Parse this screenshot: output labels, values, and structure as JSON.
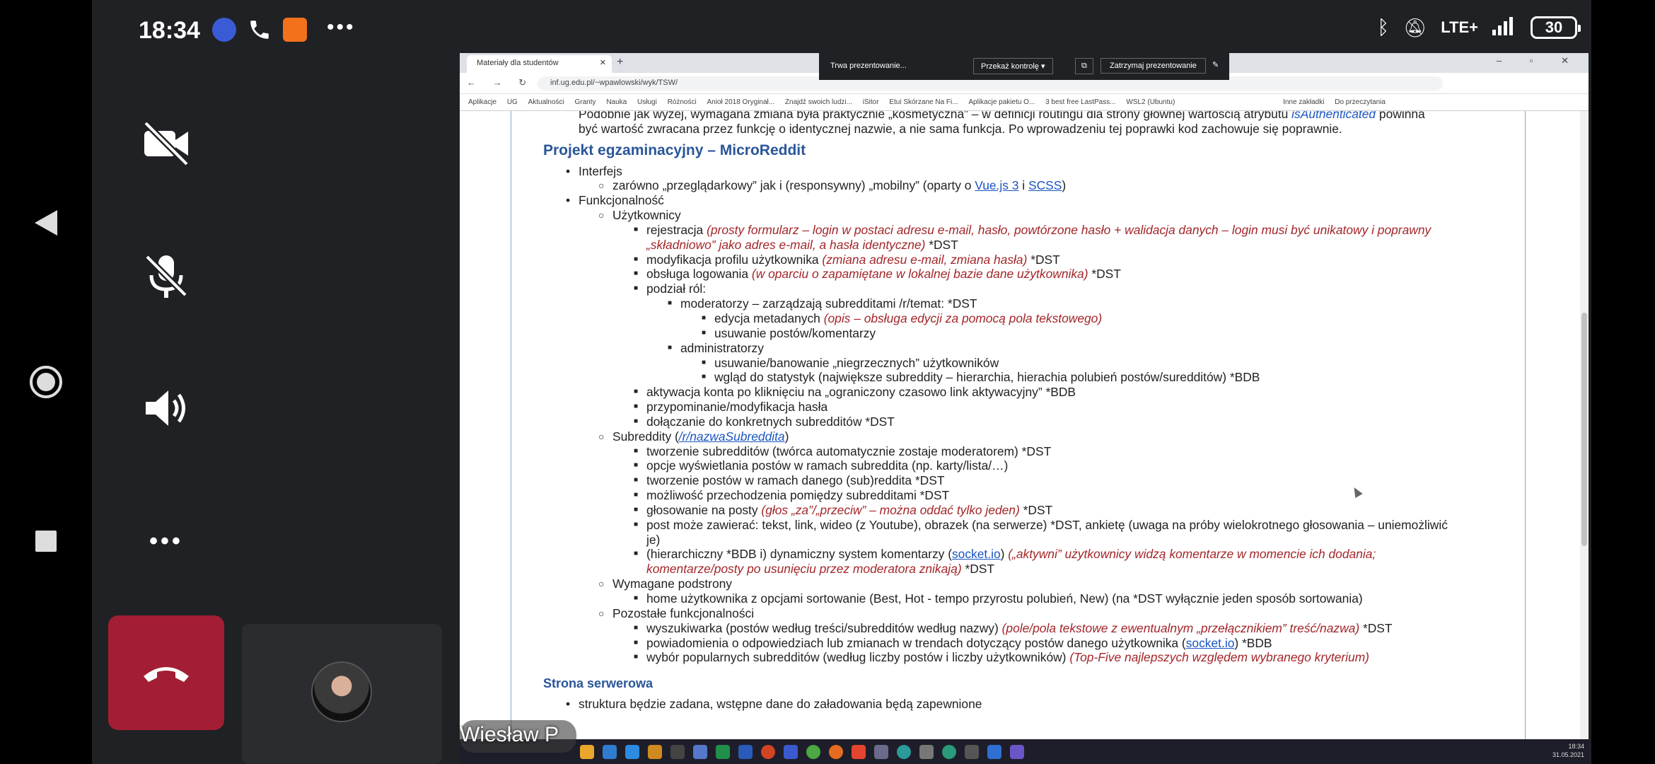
{
  "status": {
    "time": "18:34",
    "network": "LTE+",
    "battery": "30"
  },
  "call": {
    "participant_name": "Wiesław P"
  },
  "browser": {
    "tab_title": "Materiały dla studentów",
    "url": "inf.ug.edu.pl/~wpawlowski/wyk/TSW/",
    "bookmarks": [
      "Aplikacje",
      "UG",
      "Aktualności",
      "Granty",
      "Nauka",
      "Usługi",
      "Różności",
      "Anioł 2018 Oryginał...",
      "Znajdź swoich ludzi...",
      "iSitor",
      "Etui Skórzane Na Fi...",
      "Aplikacje pakietu O...",
      "3 best free LastPass...",
      "WSL2 (Ubuntu)",
      "Inne zakładki",
      "Do przeczytania"
    ],
    "presenting": {
      "status": "Trwa prezentowanie...",
      "give_control": "Przekaż kontrolę",
      "stop": "Zatrzymaj prezentowanie"
    }
  },
  "doc": {
    "intro_a": "Podobnie jak wyżej, wymagana zmiana była praktycznie „kosmetyczna” – w definicji routingu dla strony głównej wartością atrybutu ",
    "intro_code": "isAuthenticated",
    "intro_b": " powinna",
    "intro_line2": "być wartość zwracana przez funkcję o identycznej nazwie, a nie sama funkcja. Po wprowadzeniu tej poprawki kod zachowuje się poprawnie.",
    "h_project": "Projekt egzaminacyjny – MicroReddit",
    "interfejs": "Interfejs",
    "interfejs_sub_a": "zarówno „przeglądarkowy” jak i (responsywny) „mobilny” (oparty o ",
    "vue": "Vue.js 3",
    "and": " i ",
    "scss": "SCSS",
    "close_paren": ")",
    "funkcjonalnosc": "Funkcjonalność",
    "uzytkownicy": "Użytkownicy",
    "rejestracja": "rejestracja ",
    "rejestracja_it": "(prosty formularz – login w postaci adresu e-mail, hasło, powtórzone hasło + walidacja danych – login musi być unikatowy i poprawny",
    "rejestracja_it2": "„składniowo” jako adres e-mail, a hasła identyczne)",
    "dst": " *DST",
    "modyfikacja": "modyfikacja profilu użytkownika ",
    "modyfikacja_it": "(zmiana adresu e-mail, zmiana hasła)",
    "logowanie": "obsługa logowania ",
    "logowanie_it": "(w oparciu o zapamiętane w lokalnej bazie dane użytkownika)",
    "podzial": "podział ról:",
    "moderatorzy": "moderatorzy – zarządzają subredditami /r/temat: *DST",
    "edycja": "edycja metadanych ",
    "edycja_it": "(opis – obsługa edycji za pomocą pola tekstowego)",
    "usuwanie_postow": "usuwanie postów/komentarzy",
    "administratorzy": "administratorzy",
    "banowanie": "usuwanie/banowanie „niegrzecznych” użytkowników",
    "statystyki": "wgląd do statystyk (największe subreddity – hierarchia, hierachia polubień postów/suredditów) *BDB",
    "aktywacja": "aktywacja konta po kliknięciu na „ograniczony czasowo link aktywacyjny” *BDB",
    "przypominanie": "przypominanie/modyfikacja hasła",
    "dolaczanie": "dołączanie do konkretnych subredditów *DST",
    "subreddity_a": "Subreddity (",
    "subreddity_link": "/r/nazwaSubreddita",
    "tworzenie_sub": "tworzenie subredditów (twórca automatycznie zostaje moderatorem) *DST",
    "opcje": "opcje wyświetlania postów w ramach subreddita (np. karty/lista/…)",
    "tworzenie_postow": "tworzenie postów w ramach danego (sub)reddita *DST",
    "przechodzenie": "możliwość przechodzenia pomiędzy subredditami *DST",
    "glosowanie": "głosowanie na posty ",
    "glosowanie_it": "(głos „za”/„przeciw” – można oddać tylko jeden)",
    "post_zawierac": "post może zawierać: tekst, link, wideo (z Youtube), obrazek (na serwerze) *DST, ankietę (uwaga na próby wielokrotnego głosowania – uniemożliwić",
    "post_zawierac2": "je)",
    "komentarze_a": "(hierarchiczny *BDB i) dynamiczny system komentarzy (",
    "socket": "socket.io",
    "komentarze_b": ") ",
    "komentarze_it": "(„aktywni” użytkownicy widzą komentarze w momencie ich dodania;",
    "komentarze_it2": "komentarze/posty po usunięciu przez moderatora znikają)",
    "wymagane": "Wymagane podstrony",
    "home": "home użytkownika z opcjami sortowanie (Best, Hot - tempo przyrostu polubień, New) (na *DST wyłącznie jeden sposób sortowania)",
    "pozostale": "Pozostałe funkcjonalności",
    "wyszukiwarka": "wyszukiwarka (postów według treści/subredditów według nazwy) ",
    "wyszukiwarka_it": "(pole/pola tekstowe z ewentualnym „przełącznikiem” treść/nazwa)",
    "powiadomienia_a": "powiadomienia o odpowiedziach lub zmianach w trendach dotyczący postów danego użytkownika (",
    "powiadomienia_b": ") *BDB",
    "wybor": "wybór popularnych subredditów (według liczby postów i liczby użytkowników) ",
    "wybor_it": "(Top-Five najlepszych względem wybranego kryterium)",
    "h_server": "Strona serwerowa",
    "struktura": "struktura będzie zadana, wstępne dane do załadowania będą zapewnione"
  },
  "taskbar": {
    "time": "18:34",
    "date": "31.05.2021"
  }
}
